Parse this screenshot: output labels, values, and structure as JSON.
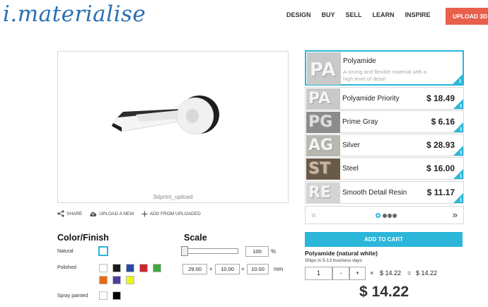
{
  "header": {
    "logo_text": "i.materialise",
    "nav": [
      "DESIGN",
      "BUY",
      "SELL",
      "LEARN",
      "INSPIRE"
    ],
    "upload_label": "UPLOAD 3D"
  },
  "viewer": {
    "caption": "3dprint_upload"
  },
  "tools": {
    "share": "SHARE",
    "upload_new": "UPLOAD A NEW",
    "add_from_uploaded": "ADD FROM UPLOADED"
  },
  "color_finish": {
    "title": "Color/Finish",
    "natural_label": "Natural",
    "polished_label": "Polished",
    "spray_label": "Spray painted",
    "polished_colors": [
      "#ffffff",
      "#1a1a1a",
      "#2b4aa8",
      "#c8262e",
      "#3eaa3e",
      "#e86a12",
      "#4a3ea0",
      "#eef21a"
    ],
    "spray_colors": [
      "#ffffff",
      "#000000"
    ],
    "accent": "#2bb6da"
  },
  "scale": {
    "title": "Scale",
    "percent": "100",
    "percent_unit": "%",
    "dim_x": "29.00",
    "dim_y": "10.00",
    "dim_z": "10.00",
    "times": "×",
    "unit": "mm"
  },
  "materials": [
    {
      "name": "Polyamide",
      "desc": "A strong and flexible material with a high level of detail",
      "price": "",
      "selected": true,
      "thumb": "PA"
    },
    {
      "name": "Polyamide Priority",
      "price": "$ 18.49",
      "thumb": "PA"
    },
    {
      "name": "Prime Gray",
      "price": "$ 6.16",
      "thumb": "PG"
    },
    {
      "name": "Silver",
      "price": "$ 28.93",
      "thumb": "AG"
    },
    {
      "name": "Steel",
      "price": "$ 16.00",
      "thumb": "ST"
    },
    {
      "name": "Smooth Detail Resin",
      "price": "$ 11.17",
      "thumb": "RE"
    }
  ],
  "pager": {
    "prev": "«",
    "next": "»"
  },
  "cart": {
    "button": "ADD TO CART",
    "selection_title": "Polyamide (natural white)",
    "shipping": "Ships in 5-13 business days",
    "quantity": "1",
    "minus": "-",
    "plus": "+",
    "times": "×",
    "unit_price": "$ 14.22",
    "equals": "=",
    "line_total": "$ 14.22",
    "total": "$ 14.22"
  }
}
